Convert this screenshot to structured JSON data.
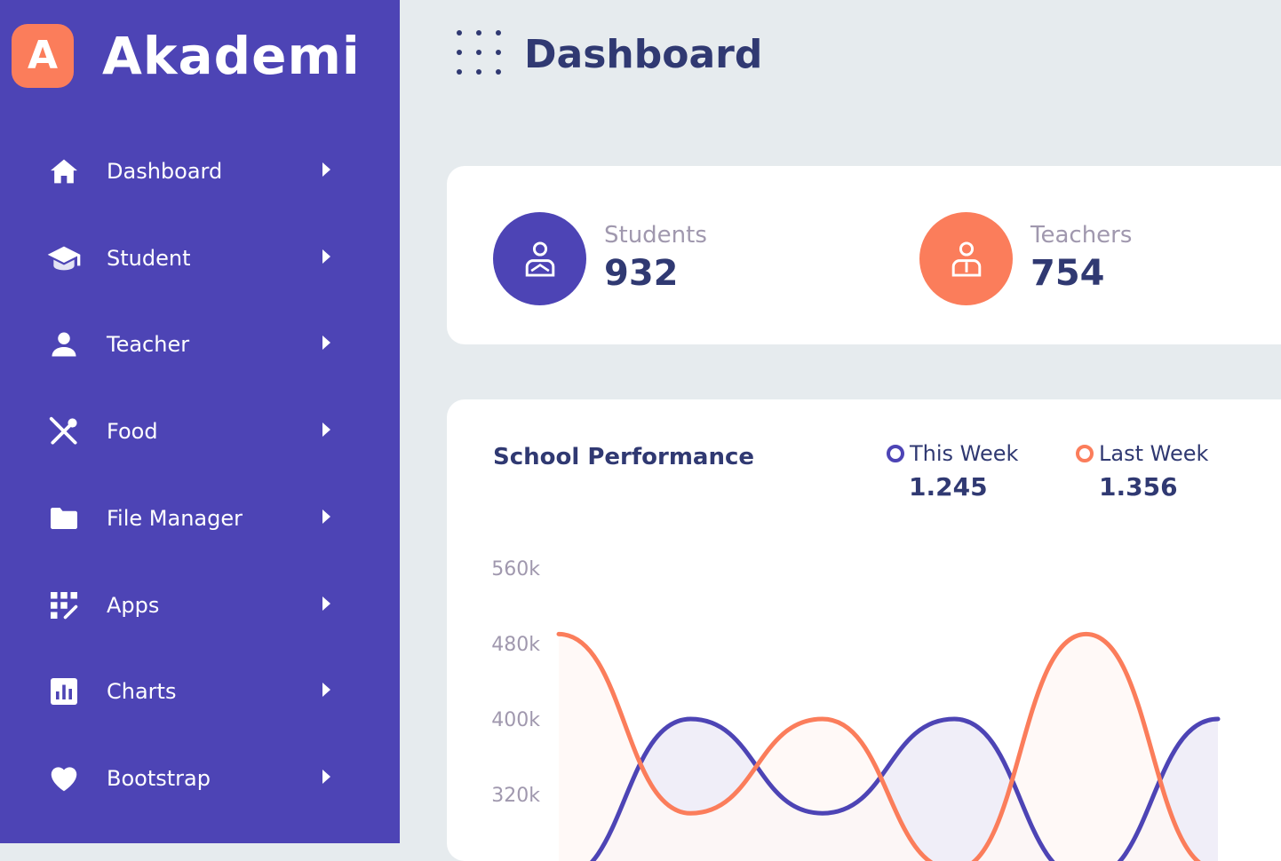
{
  "brand": {
    "initial": "A",
    "name": "Akademi"
  },
  "sidebar": {
    "items": [
      {
        "label": "Dashboard",
        "icon": "home-icon"
      },
      {
        "label": "Student",
        "icon": "graduation-cap-icon"
      },
      {
        "label": "Teacher",
        "icon": "person-icon"
      },
      {
        "label": "Food",
        "icon": "utensils-icon"
      },
      {
        "label": "File Manager",
        "icon": "folder-icon"
      },
      {
        "label": "Apps",
        "icon": "apps-grid-icon"
      },
      {
        "label": "Charts",
        "icon": "bar-chart-icon"
      },
      {
        "label": "Bootstrap",
        "icon": "heart-icon"
      }
    ]
  },
  "header": {
    "title": "Dashboard",
    "menu_icon": "dots-grid-icon"
  },
  "stats": {
    "students": {
      "label": "Students",
      "value": "932",
      "color": "#4d44b5",
      "icon": "student-icon"
    },
    "teachers": {
      "label": "Teachers",
      "value": "754",
      "color": "#fb7d5b",
      "icon": "teacher-icon"
    }
  },
  "performance": {
    "title": "School Performance",
    "this_week": {
      "label": "This Week",
      "value": "1.245",
      "color": "#4d44b5"
    },
    "last_week": {
      "label": "Last Week",
      "value": "1.356",
      "color": "#fb7d5b"
    }
  },
  "chart_data": {
    "type": "area",
    "yticks": [
      "560k",
      "480k",
      "400k",
      "320k"
    ],
    "ylim": [
      240000,
      560000
    ],
    "x": [
      0,
      1,
      2,
      3,
      4,
      5,
      6,
      7
    ],
    "series": [
      {
        "name": "This Week",
        "color": "#4d44b5",
        "fill": "#efedf8",
        "values": [
          230000,
          400000,
          300000,
          400000,
          230000,
          400000
        ]
      },
      {
        "name": "Last Week",
        "color": "#fb7d5b",
        "fill": "#fff7f5",
        "values": [
          490000,
          300000,
          400000,
          240000,
          490000,
          240000
        ]
      }
    ]
  }
}
